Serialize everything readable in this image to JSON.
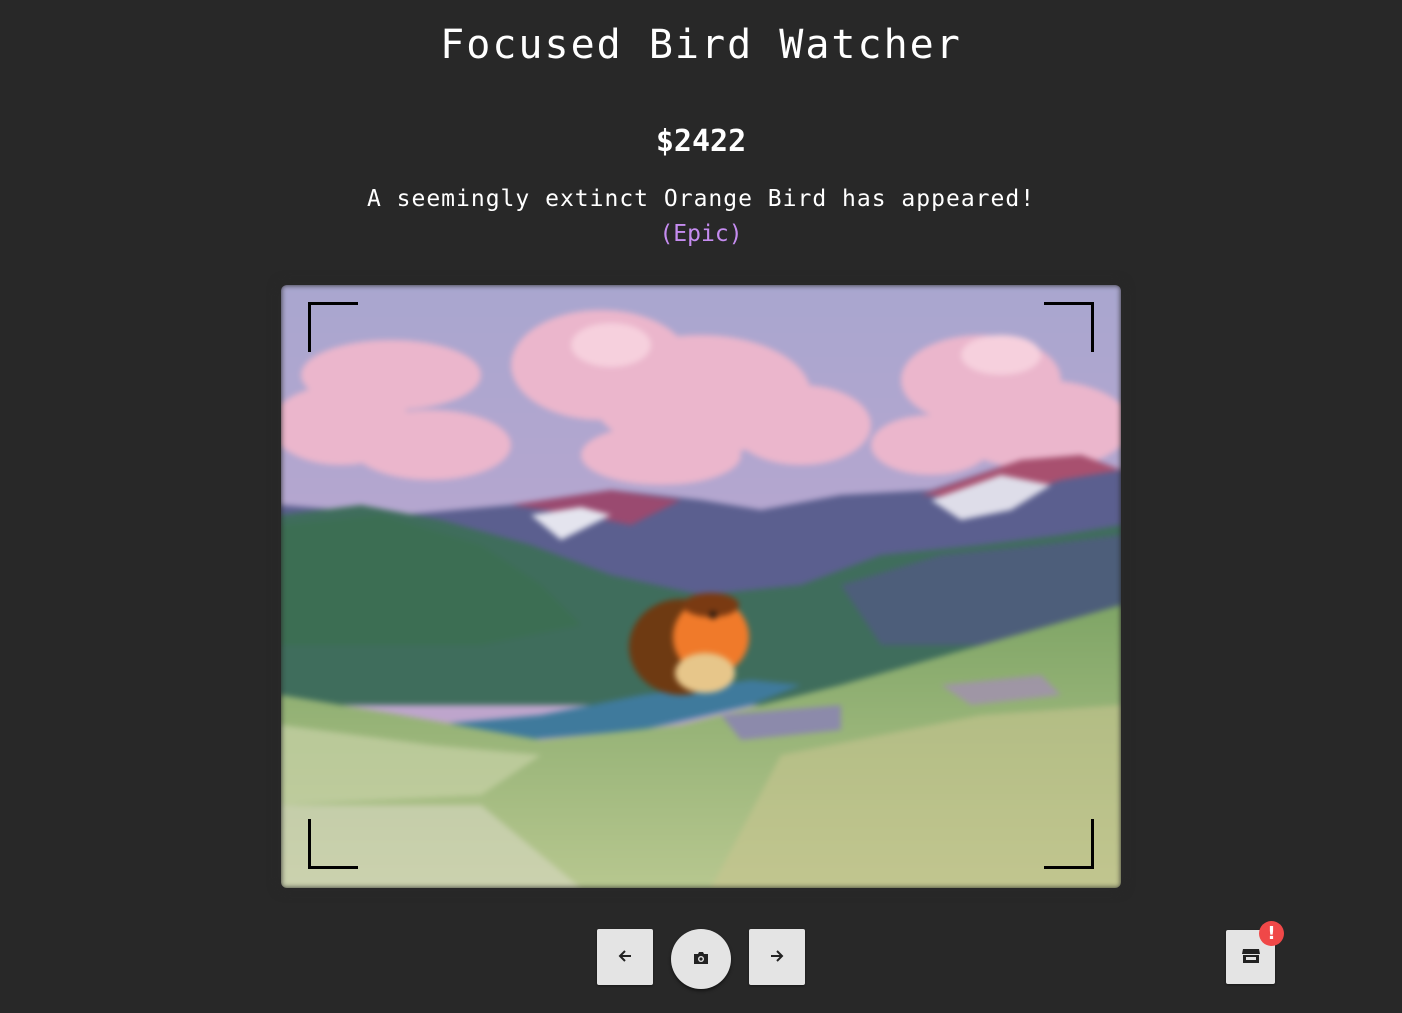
{
  "header": {
    "title": "Focused Bird Watcher"
  },
  "status": {
    "money": "$2422",
    "message": "A seemingly extinct Orange Bird has appeared!",
    "rarity": "(Epic)",
    "rarity_color": "#c58cf0"
  },
  "scene": {
    "bird": "orange-bird",
    "background": "mountain-meadow-landscape"
  },
  "controls": {
    "prev_icon": "arrow-left-icon",
    "camera_icon": "camera-icon",
    "next_icon": "arrow-right-icon",
    "shop_icon": "store-icon",
    "shop_badge": "!"
  },
  "colors": {
    "background": "#282828",
    "button": "#e4e4e4",
    "badge": "#f04848"
  }
}
